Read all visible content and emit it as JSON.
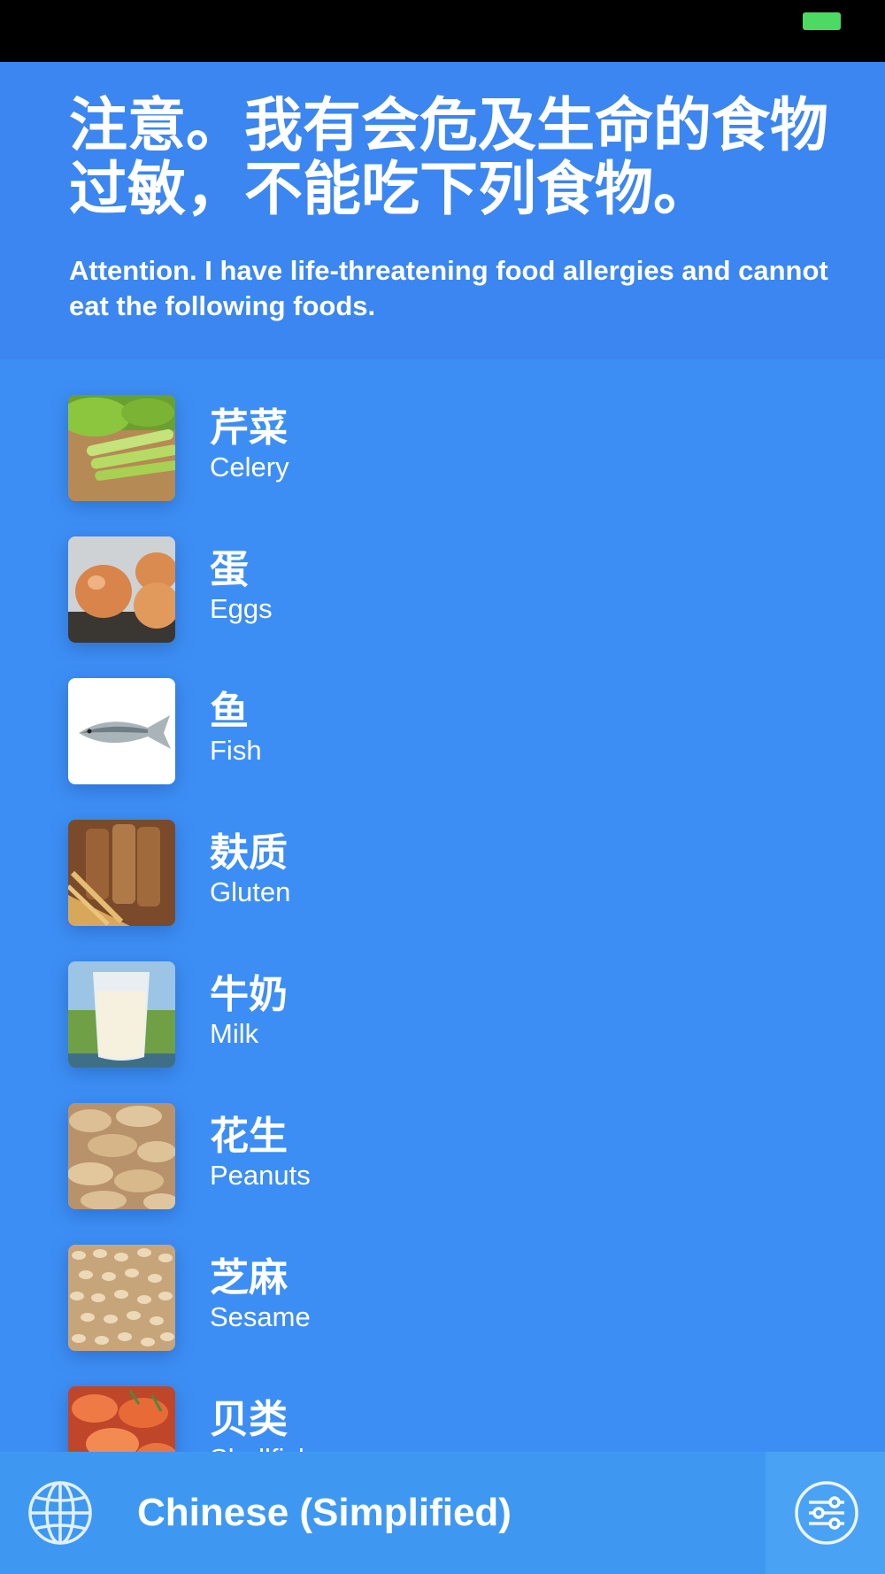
{
  "header": {
    "title_cn": "注意。我有会危及生命的食物过敏，不能吃下列食物。",
    "title_en": "Attention. I have life-threatening food allergies and cannot eat the following foods."
  },
  "foods": [
    {
      "cn": "芹菜",
      "en": "Celery",
      "icon": "celery-icon"
    },
    {
      "cn": "蛋",
      "en": "Eggs",
      "icon": "eggs-icon"
    },
    {
      "cn": "鱼",
      "en": "Fish",
      "icon": "fish-icon"
    },
    {
      "cn": "麸质",
      "en": "Gluten",
      "icon": "bread-icon"
    },
    {
      "cn": "牛奶",
      "en": "Milk",
      "icon": "milk-glass-icon"
    },
    {
      "cn": "花生",
      "en": "Peanuts",
      "icon": "peanuts-icon"
    },
    {
      "cn": "芝麻",
      "en": "Sesame",
      "icon": "sesame-icon"
    },
    {
      "cn": "贝类",
      "en": "Shellfish",
      "icon": "shrimp-icon"
    }
  ],
  "bottom_bar": {
    "language": "Chinese (Simplified)",
    "globe_icon": "globe-icon",
    "settings_icon": "sliders-icon"
  },
  "colors": {
    "background": "#3d8ef4",
    "header": "#3b86f0",
    "bottom_bar": "#3e98f2",
    "battery": "#4cd964"
  }
}
